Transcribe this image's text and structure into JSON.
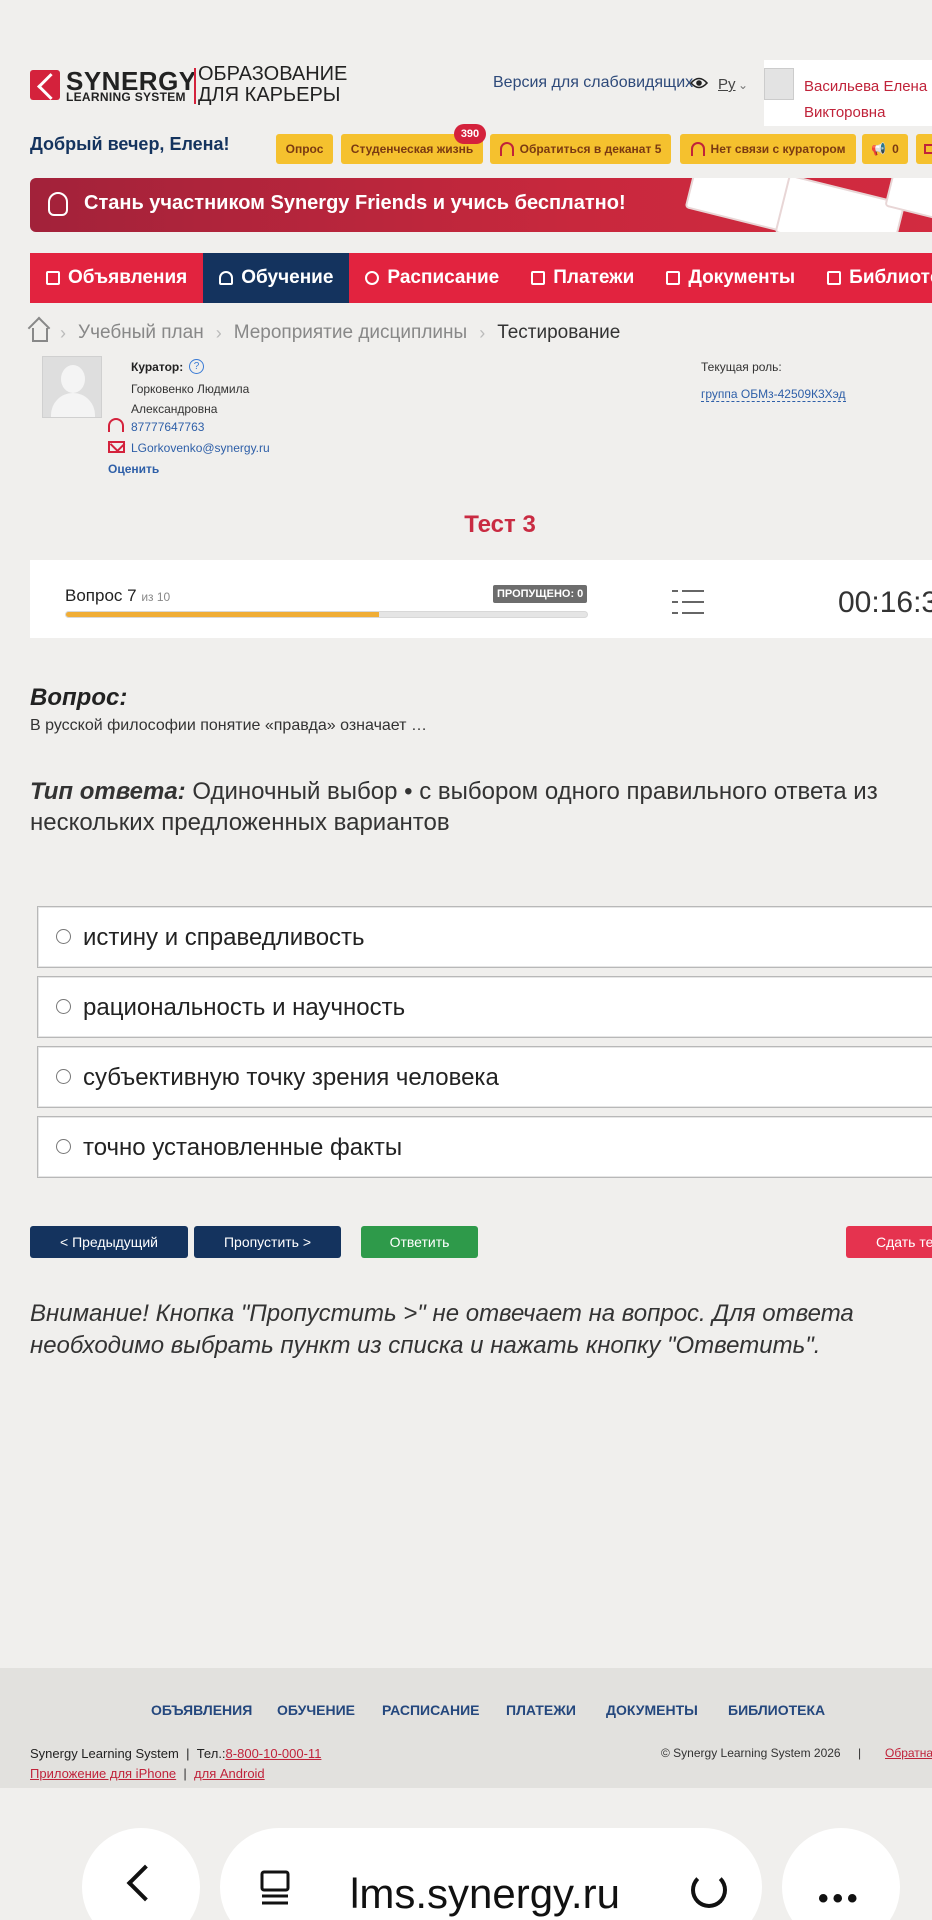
{
  "header": {
    "logo_main": "SYNERGY",
    "logo_sub": "LEARNING SYSTEM",
    "logo_tagline_1": "ОБРАЗОВАНИЕ",
    "logo_tagline_2": "ДЛЯ КАРЬЕРЫ",
    "accessibility_label": "Версия для слабовидящих",
    "language": "Ру",
    "user_first": "Васильева Елена",
    "user_second": "Викторовна"
  },
  "greeting": "Добрый вечер, Елена!",
  "chips": {
    "survey": "Опрос",
    "student_life": "Студенческая жизнь",
    "student_life_badge": "390",
    "dean": "Обратиться в деканат 5",
    "curator": "Нет связи с куратором",
    "announce_count": "0"
  },
  "banner": {
    "text": "Стань участником Synergy Friends и учись бесплатно!"
  },
  "nav": {
    "items": [
      "Объявления",
      "Обучение",
      "Расписание",
      "Платежи",
      "Документы",
      "Библиотека"
    ],
    "active_index": 1
  },
  "breadcrumb": {
    "items": [
      "Учебный план",
      "Мероприятие дисциплины",
      "Тестирование"
    ]
  },
  "curator": {
    "label": "Куратор:",
    "help": "?",
    "name_1": "Горковенко Людмила",
    "name_2": "Александровна",
    "phone": "87777647763",
    "email": "LGorkovenko@synergy.ru",
    "rate_label": "Оценить"
  },
  "role": {
    "label": "Текущая роль:",
    "value": "группа ОБМз-42509К3Хэд"
  },
  "test": {
    "title": "Тест 3",
    "question_label": "Вопрос 7",
    "question_of": "из 10",
    "skipped_label": "ПРОПУЩЕНО: 0",
    "progress": 0.6,
    "timer": "00:16:3"
  },
  "question": {
    "heading": "Вопрос:",
    "text": "В русской философии понятие «правда» означает …",
    "answer_type_label": "Тип ответа:",
    "answer_type_text": " Одиночный выбор • с выбором одного правильного ответа из нескольких предложенных вариантов"
  },
  "options": [
    "истину и справедливость",
    "рациональность и научность",
    "субъективную точку зрения человека",
    "точно установленные факты"
  ],
  "buttons": {
    "prev": "< Предыдущий",
    "skip": "Пропустить >",
    "answer": "Ответить",
    "finish": "Сдать тест"
  },
  "warning": "Внимание! Кнопка \"Пропустить >\" не отвечает на вопрос. Для ответа необходимо выбрать пункт из списка и нажать кнопку \"Ответить\".",
  "footer": {
    "nav": [
      "ОБЪЯВЛЕНИЯ",
      "ОБУЧЕНИЕ",
      "РАСПИСАНИЕ",
      "ПЛАТЕЖИ",
      "ДОКУМЕНТЫ",
      "БИБЛИОТЕКА"
    ],
    "company": "Synergy Learning System",
    "sep": "|",
    "phone_label": "Тел.:",
    "phone": "8-800-10-000-11",
    "iphone_app": "Приложение для iPhone",
    "android_app": "для Android",
    "copyright": "© Synergy Learning System 2026",
    "feedback": "Обратная связь"
  },
  "browser": {
    "url": "lms.synergy.ru"
  },
  "colors": {
    "brand_red": "#e2233f",
    "navy": "#14335e",
    "accent_yellow": "#f5c12e",
    "success_green": "#2e9a4a"
  }
}
